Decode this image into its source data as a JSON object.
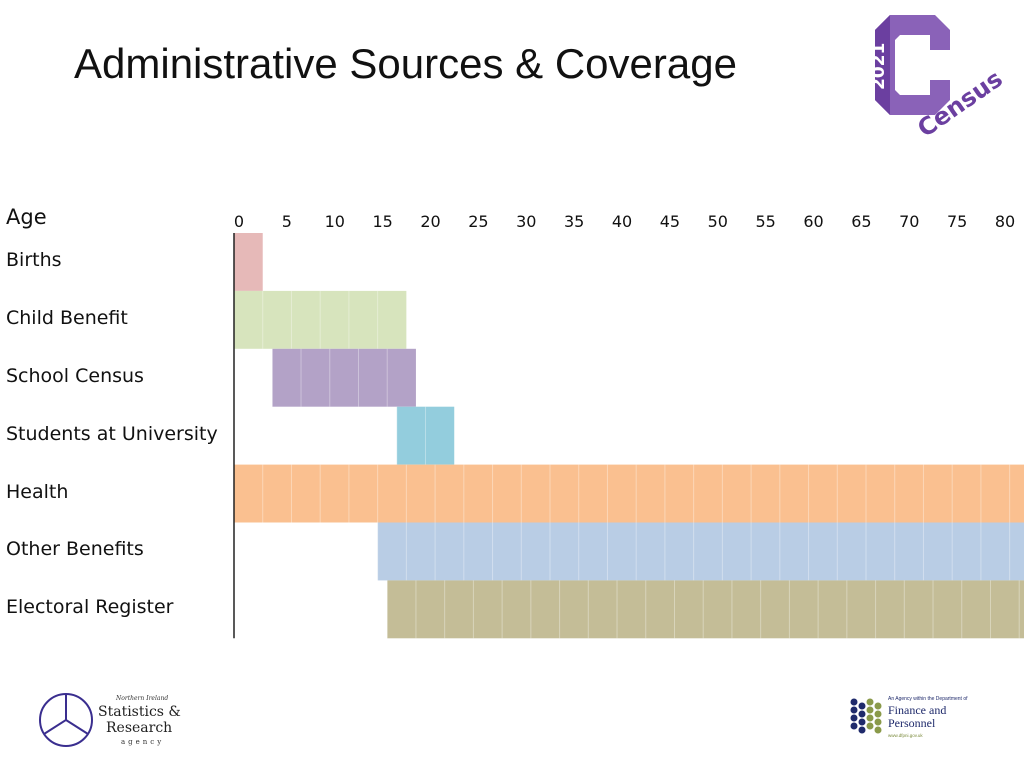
{
  "title": "Administrative Sources & Coverage",
  "logos": {
    "census": {
      "year": "2021",
      "word": "Census"
    },
    "nisra": {
      "top": "Northern Ireland",
      "line1": "Statistics &",
      "line2": "Research",
      "line3": "agency"
    },
    "dfp": {
      "tagline": "An Agency within the Department of",
      "line1": "Finance and",
      "line2": "Personnel",
      "url": "www.dfpni.gov.uk"
    }
  },
  "chart_data": {
    "type": "bar",
    "orientation": "horizontal-range",
    "title": "Administrative Sources & Coverage",
    "ylabel": "Age",
    "xlabel": "",
    "xlim": [
      0,
      82.5
    ],
    "xticks": [
      0,
      5,
      10,
      15,
      20,
      25,
      30,
      35,
      40,
      45,
      50,
      55,
      60,
      65,
      70,
      75,
      80
    ],
    "grid": false,
    "legend": "none",
    "categories": [
      "Births",
      "Child Benefit",
      "School Census",
      "Students at University",
      "Health",
      "Other Benefits",
      "Electoral Register"
    ],
    "series": [
      {
        "name": "Births",
        "start": 0,
        "end": 3,
        "color": "#e6b9b8"
      },
      {
        "name": "Child Benefit",
        "start": 0,
        "end": 18,
        "color": "#d7e4bd"
      },
      {
        "name": "School Census",
        "start": 4,
        "end": 19,
        "color": "#b3a2c7"
      },
      {
        "name": "Students at University",
        "start": 17,
        "end": 23,
        "color": "#93cddd"
      },
      {
        "name": "Health",
        "start": 0,
        "end": 82.5,
        "color": "#fac090"
      },
      {
        "name": "Other Benefits",
        "start": 15,
        "end": 82.5,
        "color": "#b9cde5"
      },
      {
        "name": "Electoral Register",
        "start": 16,
        "end": 82.5,
        "color": "#c4bd97"
      }
    ]
  }
}
